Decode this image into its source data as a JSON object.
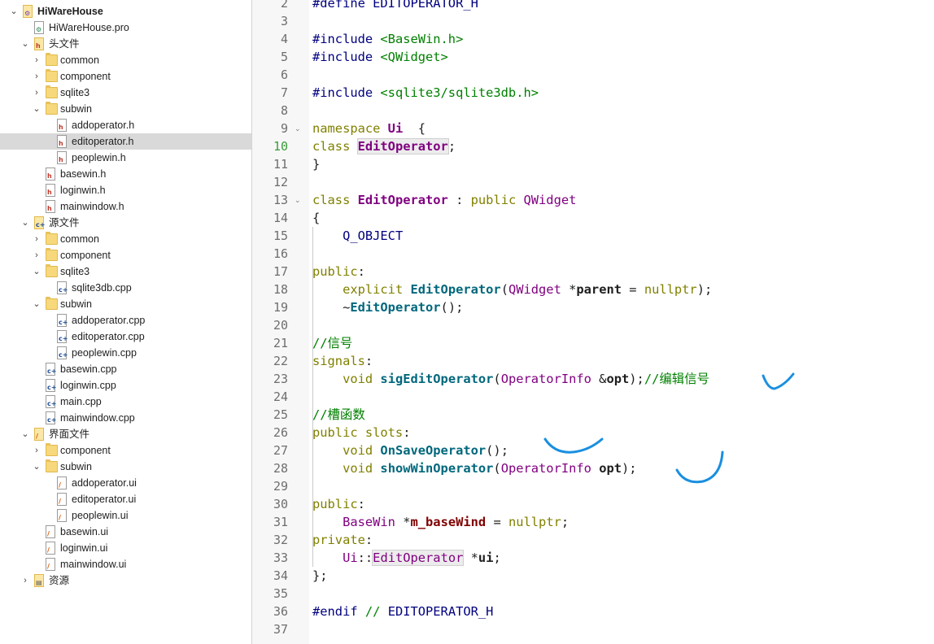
{
  "tree": {
    "items": [
      {
        "label": "HiWareHouse",
        "kind": "project",
        "depth": 0,
        "expanded": true,
        "bold": true
      },
      {
        "label": "HiWareHouse.pro",
        "kind": "pro",
        "depth": 1
      },
      {
        "label": "头文件",
        "kind": "header-group",
        "depth": 1,
        "expanded": true
      },
      {
        "label": "common",
        "kind": "folder",
        "depth": 2,
        "expanded": false
      },
      {
        "label": "component",
        "kind": "folder",
        "depth": 2,
        "expanded": false
      },
      {
        "label": "sqlite3",
        "kind": "folder",
        "depth": 2,
        "expanded": false
      },
      {
        "label": "subwin",
        "kind": "folder",
        "depth": 2,
        "expanded": true
      },
      {
        "label": "addoperator.h",
        "kind": "h",
        "depth": 3
      },
      {
        "label": "editoperator.h",
        "kind": "h",
        "depth": 3,
        "selected": true
      },
      {
        "label": "peoplewin.h",
        "kind": "h",
        "depth": 3
      },
      {
        "label": "basewin.h",
        "kind": "h",
        "depth": 2
      },
      {
        "label": "loginwin.h",
        "kind": "h",
        "depth": 2
      },
      {
        "label": "mainwindow.h",
        "kind": "h",
        "depth": 2
      },
      {
        "label": "源文件",
        "kind": "source-group",
        "depth": 1,
        "expanded": true
      },
      {
        "label": "common",
        "kind": "folder",
        "depth": 2,
        "expanded": false
      },
      {
        "label": "component",
        "kind": "folder",
        "depth": 2,
        "expanded": false
      },
      {
        "label": "sqlite3",
        "kind": "folder",
        "depth": 2,
        "expanded": true
      },
      {
        "label": "sqlite3db.cpp",
        "kind": "cpp",
        "depth": 3
      },
      {
        "label": "subwin",
        "kind": "folder",
        "depth": 2,
        "expanded": true
      },
      {
        "label": "addoperator.cpp",
        "kind": "cpp",
        "depth": 3
      },
      {
        "label": "editoperator.cpp",
        "kind": "cpp",
        "depth": 3
      },
      {
        "label": "peoplewin.cpp",
        "kind": "cpp",
        "depth": 3
      },
      {
        "label": "basewin.cpp",
        "kind": "cpp",
        "depth": 2
      },
      {
        "label": "loginwin.cpp",
        "kind": "cpp",
        "depth": 2
      },
      {
        "label": "main.cpp",
        "kind": "cpp",
        "depth": 2
      },
      {
        "label": "mainwindow.cpp",
        "kind": "cpp",
        "depth": 2
      },
      {
        "label": "界面文件",
        "kind": "form-group",
        "depth": 1,
        "expanded": true
      },
      {
        "label": "component",
        "kind": "folder",
        "depth": 2,
        "expanded": false
      },
      {
        "label": "subwin",
        "kind": "folder",
        "depth": 2,
        "expanded": true
      },
      {
        "label": "addoperator.ui",
        "kind": "ui",
        "depth": 3
      },
      {
        "label": "editoperator.ui",
        "kind": "ui",
        "depth": 3
      },
      {
        "label": "peoplewin.ui",
        "kind": "ui",
        "depth": 3
      },
      {
        "label": "basewin.ui",
        "kind": "ui",
        "depth": 2
      },
      {
        "label": "loginwin.ui",
        "kind": "ui",
        "depth": 2
      },
      {
        "label": "mainwindow.ui",
        "kind": "ui",
        "depth": 2
      },
      {
        "label": "资源",
        "kind": "resource-group",
        "depth": 1,
        "expanded": false
      }
    ]
  },
  "editor": {
    "current_line": 10,
    "lines": [
      {
        "n": "2",
        "seg": [
          [
            "pre",
            "#define "
          ],
          [
            "mac",
            "EDITOPERATOR_H"
          ]
        ]
      },
      {
        "n": "3",
        "seg": []
      },
      {
        "n": "4",
        "seg": [
          [
            "pre",
            "#include "
          ],
          [
            "inc",
            "<BaseWin.h>"
          ]
        ]
      },
      {
        "n": "5",
        "seg": [
          [
            "pre",
            "#include "
          ],
          [
            "inc",
            "<QWidget>"
          ]
        ]
      },
      {
        "n": "6",
        "seg": []
      },
      {
        "n": "7",
        "seg": [
          [
            "pre",
            "#include "
          ],
          [
            "inc",
            "<sqlite3/sqlite3db.h>"
          ]
        ]
      },
      {
        "n": "8",
        "seg": []
      },
      {
        "n": "9",
        "fold": true,
        "seg": [
          [
            "kw",
            "namespace "
          ],
          [
            "tyb",
            "Ui"
          ],
          [
            "",
            "  {"
          ]
        ]
      },
      {
        "n": "10",
        "seg": [
          [
            "kw",
            "class "
          ],
          [
            "tyb ref",
            "EditOperator"
          ],
          [
            "",
            ";"
          ]
        ]
      },
      {
        "n": "11",
        "seg": [
          [
            "",
            "}"
          ]
        ]
      },
      {
        "n": "12",
        "seg": []
      },
      {
        "n": "13",
        "fold": true,
        "seg": [
          [
            "kw",
            "class "
          ],
          [
            "tyb",
            "EditOperator"
          ],
          [
            "",
            " : "
          ],
          [
            "kw",
            "public "
          ],
          [
            "ty",
            "QWidget"
          ]
        ]
      },
      {
        "n": "14",
        "seg": [
          [
            "",
            "{"
          ]
        ]
      },
      {
        "n": "15",
        "seg": [
          [
            "",
            "    "
          ],
          [
            "mac",
            "Q_OBJECT"
          ]
        ]
      },
      {
        "n": "16",
        "seg": []
      },
      {
        "n": "17",
        "seg": [
          [
            "kw",
            "public"
          ],
          [
            "",
            ":"
          ]
        ]
      },
      {
        "n": "18",
        "seg": [
          [
            "",
            "    "
          ],
          [
            "kw",
            "explicit "
          ],
          [
            "fn",
            "EditOperator"
          ],
          [
            "",
            "("
          ],
          [
            "ty",
            "QWidget"
          ],
          [
            "",
            " *"
          ],
          [
            "bx",
            "parent"
          ],
          [
            "",
            " = "
          ],
          [
            "kw",
            "nullptr"
          ],
          [
            "",
            ");"
          ]
        ]
      },
      {
        "n": "19",
        "seg": [
          [
            "",
            "    ~"
          ],
          [
            "fn",
            "EditOperator"
          ],
          [
            "",
            "();"
          ]
        ]
      },
      {
        "n": "20",
        "seg": []
      },
      {
        "n": "21",
        "seg": [
          [
            "cm",
            "//信号"
          ]
        ]
      },
      {
        "n": "22",
        "seg": [
          [
            "kw",
            "signals"
          ],
          [
            "",
            ":"
          ]
        ]
      },
      {
        "n": "23",
        "seg": [
          [
            "",
            "    "
          ],
          [
            "kw",
            "void "
          ],
          [
            "fn",
            "sigEditOperator"
          ],
          [
            "",
            "("
          ],
          [
            "ty",
            "OperatorInfo"
          ],
          [
            "",
            " &"
          ],
          [
            "bx",
            "opt"
          ],
          [
            "",
            ");"
          ],
          [
            "cm",
            "//编辑信号"
          ]
        ]
      },
      {
        "n": "24",
        "seg": []
      },
      {
        "n": "25",
        "seg": [
          [
            "cm",
            "//槽函数"
          ]
        ]
      },
      {
        "n": "26",
        "seg": [
          [
            "kw",
            "public slots"
          ],
          [
            "",
            ":"
          ]
        ]
      },
      {
        "n": "27",
        "seg": [
          [
            "",
            "    "
          ],
          [
            "kw",
            "void "
          ],
          [
            "fn",
            "OnSaveOperator"
          ],
          [
            "",
            "();"
          ]
        ]
      },
      {
        "n": "28",
        "seg": [
          [
            "",
            "    "
          ],
          [
            "kw",
            "void "
          ],
          [
            "fn",
            "showWinOperator"
          ],
          [
            "",
            "("
          ],
          [
            "ty",
            "OperatorInfo"
          ],
          [
            "",
            " "
          ],
          [
            "bx",
            "opt"
          ],
          [
            "",
            ");"
          ]
        ]
      },
      {
        "n": "29",
        "seg": []
      },
      {
        "n": "30",
        "seg": [
          [
            "kw",
            "public"
          ],
          [
            "",
            ":"
          ]
        ]
      },
      {
        "n": "31",
        "seg": [
          [
            "",
            "    "
          ],
          [
            "ty",
            "BaseWin"
          ],
          [
            "",
            " *"
          ],
          [
            "mem",
            "m_baseWind"
          ],
          [
            "",
            " = "
          ],
          [
            "kw",
            "nullptr"
          ],
          [
            "",
            ";"
          ]
        ]
      },
      {
        "n": "32",
        "seg": [
          [
            "kw",
            "private"
          ],
          [
            "",
            ":"
          ]
        ]
      },
      {
        "n": "33",
        "seg": [
          [
            "",
            "    "
          ],
          [
            "ty",
            "Ui"
          ],
          [
            "",
            "::"
          ],
          [
            "ty ref",
            "EditOperator"
          ],
          [
            "",
            " *"
          ],
          [
            "bx",
            "ui"
          ],
          [
            "",
            ";"
          ]
        ]
      },
      {
        "n": "34",
        "seg": [
          [
            "",
            "};"
          ]
        ]
      },
      {
        "n": "35",
        "seg": []
      },
      {
        "n": "36",
        "seg": [
          [
            "pre",
            "#endif "
          ],
          [
            "cm",
            "// "
          ],
          [
            "mac",
            "EDITOPERATOR_H"
          ]
        ]
      },
      {
        "n": "37",
        "seg": []
      }
    ]
  },
  "annotations": {
    "ink_color": "#1a8fe0"
  }
}
